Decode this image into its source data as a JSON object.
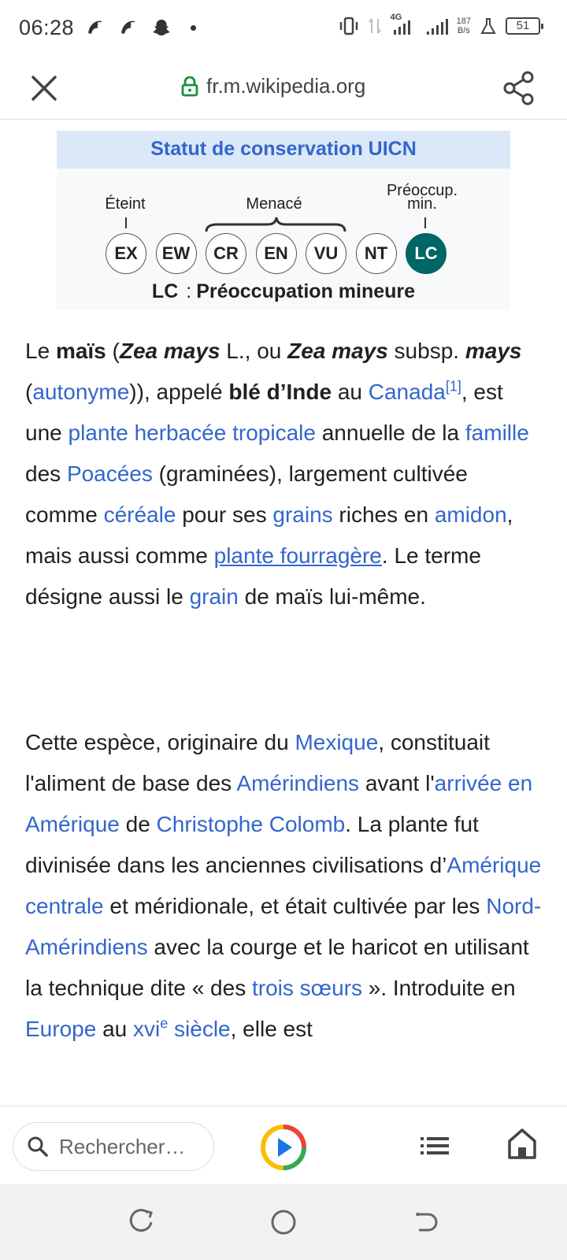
{
  "status_bar": {
    "time": "06:28",
    "network": "4G",
    "speed_value": "187",
    "speed_unit": "B/s",
    "battery": "51"
  },
  "browser": {
    "url": "fr.m.wikipedia.org",
    "accent": "#1e8e3e"
  },
  "uicn": {
    "title": "Statut de conservation UICN",
    "label_extinct": "Éteint",
    "label_threatened": "Menacé",
    "label_least_concern_l1": "Préoccup.",
    "label_least_concern_l2": "min.",
    "categories": [
      "EX",
      "EW",
      "CR",
      "EN",
      "VU",
      "NT",
      "LC"
    ],
    "active_category": "LC",
    "status_code": "LC",
    "status_text": "Préoccupation mineure"
  },
  "article": {
    "p1": {
      "t1": "Le ",
      "b_mais": "maïs",
      "t2": " (",
      "bi_zea1": "Zea mays",
      "t3": " L., ou ",
      "bi_zea2": "Zea mays",
      "t4": " subsp. ",
      "bi_mays": "mays",
      "t5": " (",
      "l_autonyme": "autonyme",
      "t6": ")), appelé ",
      "b_ble": "blé d’Inde",
      "t7": " au ",
      "l_canada": "Canada",
      "ref1": "[1]",
      "t8": ", est une ",
      "l_plante_herbacee": "plante herbacée tropicale",
      "t9": " annuelle de la ",
      "l_famille": "famille",
      "t10": " des ",
      "l_poacees": "Poacées",
      "t11": " (graminées), largement cultivée comme ",
      "l_cereale": "céréale",
      "t12": " pour ses ",
      "l_grains": "grains",
      "t13": " riches en ",
      "l_amidon": "amidon",
      "t14": ", mais aussi comme ",
      "l_fourragere": "plante fourragère",
      "t15": ". Le terme désigne aussi le ",
      "l_grain": "grain",
      "t16": " de maïs lui-même."
    },
    "p2": {
      "t1": "Cette espèce, originaire du ",
      "l_mexique": "Mexique",
      "t2": ", constituait l'aliment de base des ",
      "l_amerindiens": "Amérindiens",
      "t3": " avant l'",
      "l_arrivee": "arrivée en Amérique",
      "t4": " de ",
      "l_colomb": "Christophe Colomb",
      "t5": ". La plante fut divinisée dans les anciennes civilisations d’",
      "l_amerique_centrale": "Amérique centrale",
      "t6": " et méridionale, et était cultivée par les ",
      "l_nord_amerindiens": "Nord-Amérindiens",
      "t7": " avec la courge et le haricot en utilisant la technique dite « des ",
      "l_trois_soeurs": "trois sœurs",
      "t8": " ». Introduite en ",
      "l_europe": "Europe",
      "t9": " au ",
      "l_xvi": "xvi",
      "l_xvi_sup": "e",
      "l_siecle": " siècle",
      "t10": ", elle est"
    }
  },
  "bottom_bar": {
    "search_placeholder": "Rechercher…"
  }
}
